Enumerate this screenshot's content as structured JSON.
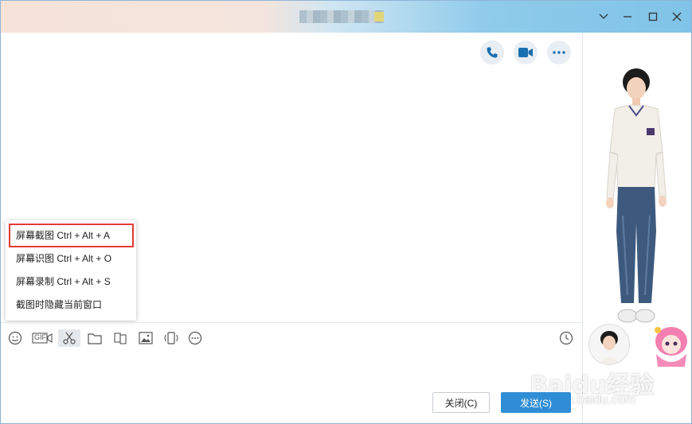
{
  "window": {
    "title_obscured": true
  },
  "titlebar": {
    "buttons": [
      {
        "name": "chevron-down-icon"
      },
      {
        "name": "minimize-icon"
      },
      {
        "name": "maximize-icon"
      },
      {
        "name": "close-icon"
      }
    ]
  },
  "chat_actions": [
    {
      "name": "phone-call-button",
      "icon": "phone-icon"
    },
    {
      "name": "video-call-button",
      "icon": "video-camera-icon"
    },
    {
      "name": "more-options-button",
      "icon": "ellipsis-icon"
    }
  ],
  "screenshot_menu": {
    "items": [
      {
        "label": "屏幕截图 Ctrl + Alt + A",
        "highlighted": true
      },
      {
        "label": "屏幕识图 Ctrl + Alt + O"
      },
      {
        "label": "屏幕录制 Ctrl + Alt + S"
      },
      {
        "label": "截图时隐藏当前窗口"
      }
    ]
  },
  "toolbar": {
    "gif_label": "GIF",
    "icons": [
      "smiley-icon",
      "gif-icon",
      "scissors-icon",
      "folder-icon",
      "file-transfer-icon",
      "image-icon",
      "shake-icon",
      "more-circle-icon",
      "history-clock-icon"
    ]
  },
  "footer": {
    "close_label": "关闭(C)",
    "send_label": "发送(S)"
  },
  "watermark": {
    "logo_text": "Baidu经验",
    "sub_text": "jingyan.baidu.com"
  },
  "colors": {
    "send_button": "#2f8dd6",
    "highlight_border": "#e23b35",
    "titlebar_left": "#f5e3da",
    "titlebar_right": "#7fc3e8"
  }
}
